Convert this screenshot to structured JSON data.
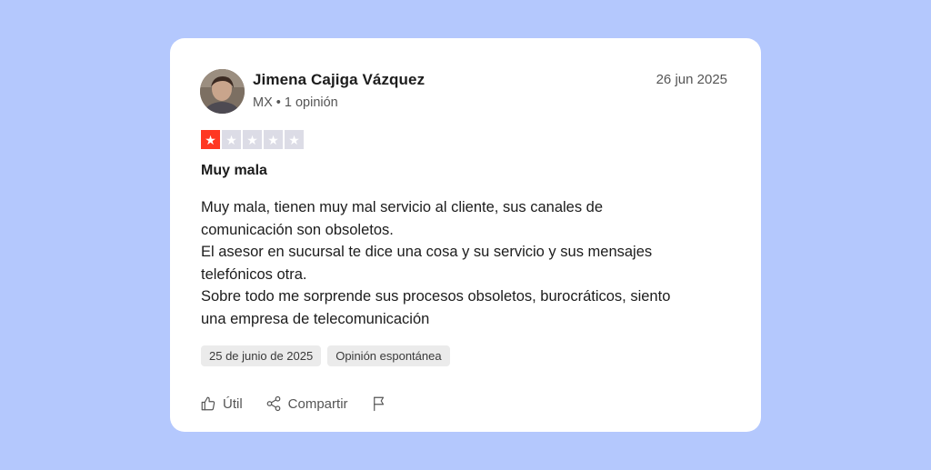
{
  "review": {
    "reviewer_name": "Jimena Cajiga Vázquez",
    "reviewer_meta": "MX • 1 opinión",
    "date": "26 jun 2025",
    "rating": 1,
    "rating_max": 5,
    "title": "Muy mala",
    "body_lines": [
      "Muy mala, tienen muy mal servicio al cliente, sus canales de",
      "comunicación son obsoletos.",
      "El asesor en sucursal te dice una cosa y su servicio y sus mensajes",
      "telefónicos otra.",
      "Sobre todo me sorprende sus procesos obsoletos, burocráticos, siento",
      "una empresa de telecomunicación"
    ],
    "tags": [
      "25 de junio de 2025",
      "Opinión espontánea"
    ]
  },
  "actions": {
    "useful_label": "Útil",
    "share_label": "Compartir"
  },
  "colors": {
    "background": "#b4c8fd",
    "star_filled": "#ff3722",
    "star_empty": "#dcdce6"
  },
  "icons": [
    "thumbs-up-icon",
    "share-icon",
    "flag-icon",
    "star-icon"
  ]
}
